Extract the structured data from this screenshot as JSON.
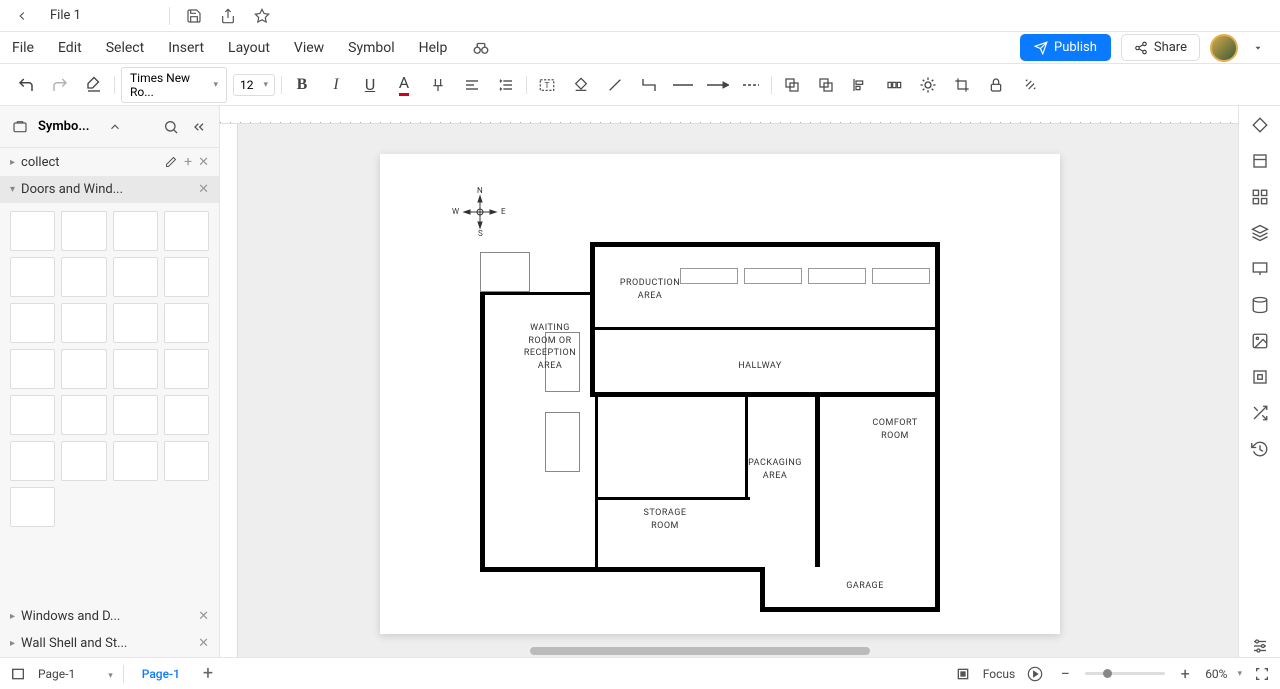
{
  "topbar": {
    "file_name": "File 1"
  },
  "menubar": {
    "items": [
      "File",
      "Edit",
      "Select",
      "Insert",
      "Layout",
      "View",
      "Symbol",
      "Help"
    ],
    "publish": "Publish",
    "share": "Share"
  },
  "toolbar": {
    "font": "Times New Ro...",
    "font_size": "12"
  },
  "sidebar": {
    "title": "Symbo...",
    "collect": "collect",
    "sections": {
      "doors": "Doors and Wind...",
      "windows": "Windows and D...",
      "wall": "Wall Shell and St..."
    }
  },
  "floorplan": {
    "compass": {
      "n": "N",
      "s": "S",
      "e": "E",
      "w": "W"
    },
    "rooms": {
      "production": "PRODUCTION AREA",
      "waiting": "WAITING ROOM OR RECEPTION AREA",
      "hallway": "HALLWAY",
      "comfort": "COMFORT ROOM",
      "packaging": "PACKAGING AREA",
      "storage": "STORAGE ROOM",
      "garage": "GARAGE"
    }
  },
  "bottombar": {
    "page_dropdown": "Page-1",
    "page_tab": "Page-1",
    "focus": "Focus",
    "zoom": "60%"
  }
}
